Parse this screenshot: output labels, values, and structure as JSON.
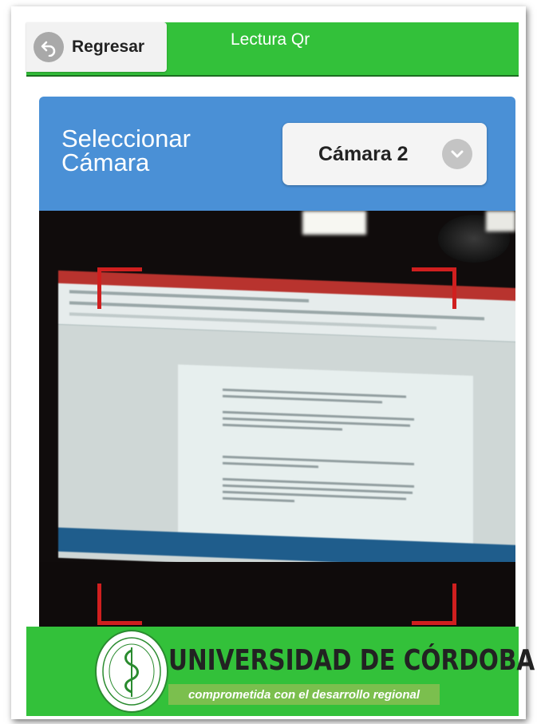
{
  "header": {
    "back_label": "Regresar",
    "title": "Lectura Qr"
  },
  "camera_selector": {
    "label_line1": "Seleccionar",
    "label_line2": "Cámara",
    "selected_value": "Cámara 2"
  },
  "footer": {
    "logo_name": "UNIVERSIDAD DE CÓRDOBA",
    "logo_slogan": "comprometida con el desarrollo regional"
  },
  "colors": {
    "header_green": "#33c13a",
    "panel_blue": "#4a90d6",
    "scan_corner_red": "#d01f1f"
  },
  "icons": {
    "back": "undo-arrow-icon",
    "dropdown": "chevron-down-icon",
    "seal": "university-seal-icon"
  }
}
